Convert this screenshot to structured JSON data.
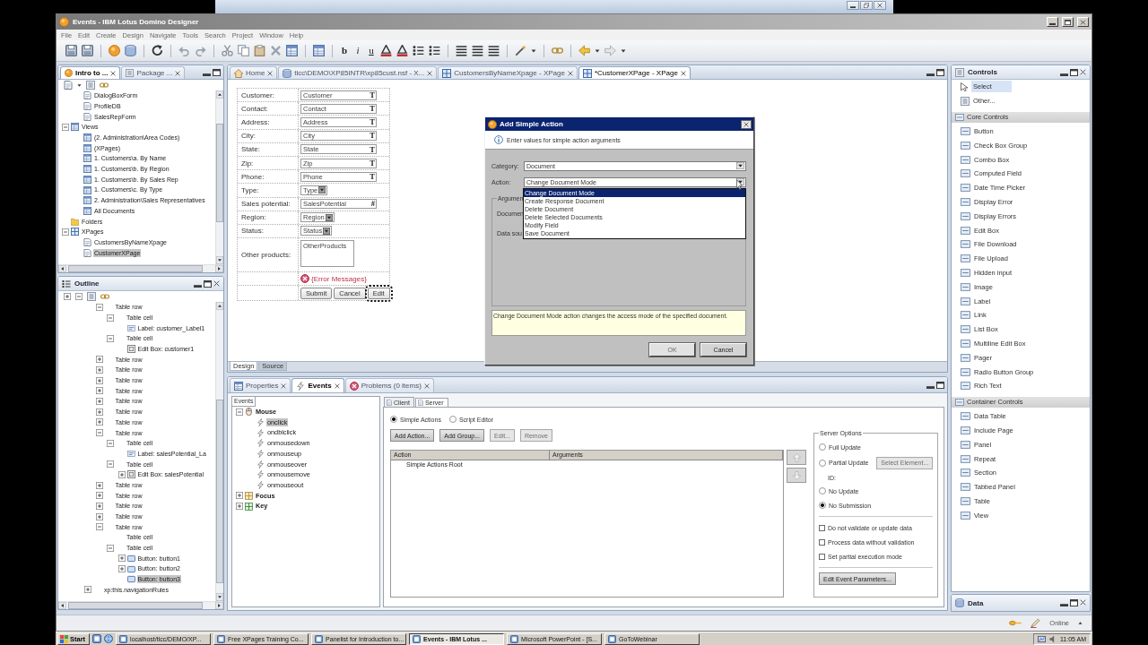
{
  "window": {
    "title": "Events - IBM Lotus Domino Designer"
  },
  "menu": [
    "File",
    "Edit",
    "Create",
    "Design",
    "Navigate",
    "Tools",
    "Search",
    "Project",
    "Window",
    "Help"
  ],
  "toolbar": {
    "glyphs": [
      "b",
      "i",
      "u"
    ]
  },
  "navigator": {
    "tabs": [
      {
        "label": "Intro to ...",
        "selected": true
      },
      {
        "label": "Package ...",
        "selected": false
      }
    ],
    "tree": [
      {
        "children": [
          {
            "label": "DialogBoxForm",
            "kind": "form",
            "selected": false
          },
          {
            "label": "ProfileDB",
            "kind": "form",
            "selected": false
          },
          {
            "label": "SalesRepForm",
            "kind": "form",
            "selected": false
          }
        ]
      },
      {
        "label": "Views",
        "kind": "views",
        "expanded": true,
        "selected": false,
        "children": [
          {
            "label": "(2. Administration\\Area Codes)",
            "kind": "view",
            "selected": false
          },
          {
            "label": "(XPages)",
            "kind": "view",
            "selected": false
          },
          {
            "label": "1. Customers\\a. By Name",
            "kind": "view",
            "selected": false
          },
          {
            "label": "1. Customers\\b. By Region",
            "kind": "view",
            "selected": false
          },
          {
            "label": "1. Customers\\b. By Sales Rep",
            "kind": "view",
            "selected": false
          },
          {
            "label": "1. Customers\\c. By Type",
            "kind": "view",
            "selected": false
          },
          {
            "label": "2. Administration\\Sales Representatives",
            "kind": "view",
            "selected": false
          },
          {
            "label": "All Documents",
            "kind": "view",
            "selected": false
          }
        ]
      },
      {
        "label": "Folders",
        "kind": "folder",
        "selected": false
      },
      {
        "label": "XPages",
        "kind": "xpages",
        "expanded": true,
        "selected": false,
        "children": [
          {
            "label": "CustomersByNameXpage",
            "kind": "xpage",
            "selected": false
          },
          {
            "label": "CustomerXPage",
            "kind": "xpage",
            "selected": true
          }
        ]
      }
    ]
  },
  "outline": {
    "title": "Outline",
    "tree": [
      {
        "children": [
          {
            "label": "Table row",
            "expanded": true,
            "selected": false,
            "children": [
              {
                "label": "Table cell",
                "expanded": true,
                "selected": false,
                "children": [
                  {
                    "label": "Label: customer_Label1",
                    "kind": "label",
                    "selected": false
                  }
                ]
              },
              {
                "label": "Table cell",
                "expanded": true,
                "selected": false,
                "children": [
                  {
                    "label": "Edit Box: customer1",
                    "kind": "editbox",
                    "selected": false
                  }
                ]
              }
            ]
          },
          {
            "label": "Table row",
            "expanded": false,
            "selected": false
          },
          {
            "label": "Table row",
            "expanded": false,
            "selected": false
          },
          {
            "label": "Table row",
            "expanded": false,
            "selected": false
          },
          {
            "label": "Table row",
            "expanded": false,
            "selected": false
          },
          {
            "label": "Table row",
            "expanded": false,
            "selected": false
          },
          {
            "label": "Table row",
            "expanded": false,
            "selected": false
          },
          {
            "label": "Table row",
            "expanded": false,
            "selected": false
          },
          {
            "label": "Table row",
            "expanded": true,
            "selected": false,
            "children": [
              {
                "label": "Table cell",
                "expanded": true,
                "selected": false,
                "children": [
                  {
                    "label": "Label: salesPotential_La",
                    "kind": "label",
                    "selected": false
                  }
                ]
              },
              {
                "label": "Table cell",
                "expanded": true,
                "selected": false,
                "children": [
                  {
                    "label": "Edit Box: salesPotential",
                    "kind": "editbox",
                    "expanded": false,
                    "selected": false
                  }
                ]
              }
            ]
          },
          {
            "label": "Table row",
            "expanded": false,
            "selected": false
          },
          {
            "label": "Table row",
            "expanded": false,
            "selected": false
          },
          {
            "label": "Table row",
            "expanded": false,
            "selected": false
          },
          {
            "label": "Table row",
            "expanded": false,
            "selected": false
          },
          {
            "label": "Table row",
            "expanded": true,
            "selected": false,
            "children": [
              {
                "label": "Table cell",
                "selected": false
              },
              {
                "label": "Table cell",
                "expanded": true,
                "selected": false,
                "children": [
                  {
                    "label": "Button: button1",
                    "kind": "button",
                    "expanded": false,
                    "selected": false
                  },
                  {
                    "label": "Button: button2",
                    "kind": "button",
                    "expanded": false,
                    "selected": false
                  },
                  {
                    "label": "Button: button3",
                    "kind": "button",
                    "selected": true
                  }
                ]
              }
            ]
          }
        ]
      },
      {
        "label": "xp:this.navigationRules",
        "expanded": false,
        "selected": false
      }
    ]
  },
  "editor": {
    "tabs": [
      {
        "label": "Home",
        "kind": "home",
        "selected": false
      },
      {
        "label": "tlcc\\DEMO\\XP85INTR\\xp85cust.nsf - X...",
        "kind": "db",
        "selected": false
      },
      {
        "label": "CustomersByNameXpage - XPage",
        "kind": "xpage",
        "selected": false
      },
      {
        "label": "*CustomerXPage - XPage",
        "kind": "xpage",
        "selected": true
      }
    ],
    "form": {
      "rows": [
        {
          "label": "Customer:",
          "value": "Customer",
          "kind": "text",
          "marker": "T"
        },
        {
          "label": "Contact:",
          "value": "Contact",
          "kind": "text",
          "marker": "T"
        },
        {
          "label": "Address:",
          "value": "Address",
          "kind": "text",
          "marker": "T"
        },
        {
          "label": "City:",
          "value": "City",
          "kind": "text",
          "marker": "T"
        },
        {
          "label": "State:",
          "value": "State",
          "kind": "text",
          "marker": "T"
        },
        {
          "label": "Zip:",
          "value": "Zip",
          "kind": "text",
          "marker": "T"
        },
        {
          "label": "Phone:",
          "value": "Phone",
          "kind": "text",
          "marker": "T"
        },
        {
          "label": "Type:",
          "value": "Type",
          "kind": "combo"
        },
        {
          "label": "Sales potential:",
          "value": "SalesPotential",
          "kind": "text",
          "marker": "#"
        },
        {
          "label": "Region:",
          "value": "Region",
          "kind": "combo"
        },
        {
          "label": "Status:",
          "value": "Status",
          "kind": "combo"
        },
        {
          "label": "Other products:",
          "value": "OtherProducts",
          "kind": "listbox"
        }
      ],
      "error_messages": "{Error Messages}",
      "buttons": [
        {
          "label": "Submit",
          "selected": false
        },
        {
          "label": "Cancel",
          "selected": false
        },
        {
          "label": "Edit",
          "selected": true
        }
      ]
    },
    "mode_tabs": [
      {
        "label": "Design",
        "selected": true
      },
      {
        "label": "Source",
        "selected": false
      }
    ]
  },
  "dialog": {
    "title": "Add Simple Action",
    "message": "Enter values for simple action arguments",
    "category": {
      "label": "Category:",
      "value": "Document"
    },
    "action": {
      "label": "Action:",
      "value": "Change Document Mode",
      "expanded": true,
      "options": [
        {
          "label": "Change Document Mode",
          "selected": true
        },
        {
          "label": "Create Response Document",
          "selected": false
        },
        {
          "label": "Delete Document",
          "selected": false
        },
        {
          "label": "Delete Selected Documents",
          "selected": false
        },
        {
          "label": "Modify Field",
          "selected": false
        },
        {
          "label": "Save Document",
          "selected": false
        }
      ]
    },
    "arguments": {
      "title": "Argumen",
      "fields": [
        "Documen",
        "Data sou"
      ]
    },
    "description": "Change Document Mode action changes the access mode of the specified document.",
    "buttons": [
      {
        "label": "OK",
        "disabled": true
      },
      {
        "label": "Cancel",
        "disabled": false
      }
    ]
  },
  "bottom_panel": {
    "tabs": [
      {
        "label": "Properties",
        "selected": false
      },
      {
        "label": "Events",
        "selected": true
      },
      {
        "label": "Problems (0 items)",
        "selected": false
      }
    ],
    "events": {
      "header": "Events",
      "tree": [
        {
          "label": "Mouse",
          "kind": "mouse",
          "expanded": true,
          "selected": false,
          "children": [
            {
              "label": "onclick",
              "selected": true
            },
            {
              "label": "ondblclick",
              "selected": false
            },
            {
              "label": "onmousedown",
              "selected": false
            },
            {
              "label": "onmouseup",
              "selected": false
            },
            {
              "label": "onmouseover",
              "selected": false
            },
            {
              "label": "onmousemove",
              "selected": false
            },
            {
              "label": "onmouseout",
              "selected": false
            }
          ]
        },
        {
          "label": "Focus",
          "kind": "focus",
          "expanded": false,
          "selected": false
        },
        {
          "label": "Key",
          "kind": "key",
          "expanded": false,
          "selected": false
        }
      ]
    },
    "side_tabs": [
      {
        "label": "Client",
        "selected": false
      },
      {
        "label": "Server",
        "selected": true
      }
    ],
    "modes": [
      {
        "label": "Simple Actions",
        "selected": true
      },
      {
        "label": "Script Editor",
        "selected": false
      }
    ],
    "action_buttons": [
      {
        "label": "Add Action...",
        "disabled": false
      },
      {
        "label": "Add Group...",
        "disabled": false
      },
      {
        "label": "Edit...",
        "disabled": true
      },
      {
        "label": "Remove",
        "disabled": true
      }
    ],
    "table": {
      "columns": [
        "Action",
        "Arguments"
      ],
      "rows": [
        [
          "Simple Actions Root"
        ]
      ]
    },
    "move_buttons": [
      {
        "kind": "up",
        "disabled": true
      },
      {
        "kind": "down",
        "disabled": true
      }
    ],
    "server_options": {
      "title": "Server Options",
      "updates": [
        {
          "label": "Full Update",
          "selected": false
        },
        {
          "label": "Partial Update",
          "selected": false
        },
        {
          "label": "No Update",
          "selected": false
        },
        {
          "label": "No Submission",
          "selected": true
        }
      ],
      "select_element": {
        "label": "Select Element...",
        "disabled": true
      },
      "id_label": "ID:",
      "checks": [
        {
          "label": "Do not validate or update data",
          "checked": false
        },
        {
          "label": "Process data without validation",
          "checked": false
        },
        {
          "label": "Set partial execution mode",
          "checked": false
        }
      ],
      "parameters_button": "Edit Event Parameters..."
    }
  },
  "palette": {
    "title": "Controls",
    "tools": [
      {
        "label": "Select",
        "selected": true
      },
      {
        "label": "Other...",
        "selected": false
      }
    ],
    "sections": [
      {
        "title": "Core Controls",
        "items": [
          "Button",
          "Check Box Group",
          "Combo Box",
          "Computed Field",
          "Date Time Picker",
          "Display Error",
          "Display Errors",
          "Edit Box",
          "File Download",
          "File Upload",
          "Hidden input",
          "Image",
          "Label",
          "Link",
          "List Box",
          "Multiline Edit Box",
          "Pager",
          "Radio Button Group",
          "Rich Text"
        ]
      },
      {
        "title": "Container Controls",
        "items": [
          "Data Table",
          "Include Page",
          "Panel",
          "Repeat",
          "Section",
          "Tabbed Panel",
          "Table",
          "View"
        ]
      }
    ]
  },
  "data_panel": {
    "title": "Data"
  },
  "status_bar": {
    "mode": "Online"
  },
  "taskbar": {
    "start": "Start",
    "items": [
      {
        "label": "localhost/tlcc/DEMO/XP...",
        "selected": false
      },
      {
        "label": "Free XPages Training Co...",
        "selected": false
      },
      {
        "label": "Panelist for Introduction to...",
        "selected": false
      },
      {
        "label": "Events - IBM Lotus ...",
        "selected": true
      },
      {
        "label": "Microsoft PowerPoint - [S...",
        "selected": false
      },
      {
        "label": "GoToWebinar",
        "selected": false
      }
    ],
    "clock": "11:05 AM"
  }
}
